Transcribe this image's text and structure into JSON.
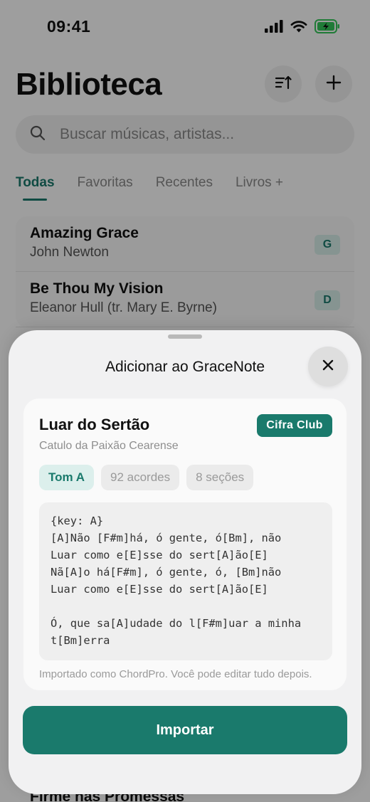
{
  "status_bar": {
    "time": "09:41",
    "icons": [
      "cellular-signal-icon",
      "wifi-icon",
      "battery-charging-icon"
    ],
    "battery_color": "#34c759"
  },
  "header": {
    "title": "Biblioteca",
    "sort_icon": "sort-icon",
    "add_icon": "plus-icon"
  },
  "search": {
    "placeholder": "Buscar músicas, artistas..."
  },
  "tabs": [
    {
      "label": "Todas",
      "active": true
    },
    {
      "label": "Favoritas",
      "active": false
    },
    {
      "label": "Recentes",
      "active": false
    },
    {
      "label": "Livros +",
      "active": false
    }
  ],
  "songs": [
    {
      "title": "Amazing Grace",
      "artist": "John Newton",
      "key": "G"
    },
    {
      "title": "Be Thou My Vision",
      "artist": "Eleanor Hull (tr. Mary E. Byrne)",
      "key": "D"
    }
  ],
  "peek_song_title": "Firme nas Promessas",
  "sheet": {
    "title": "Adicionar ao GraceNote",
    "close_icon": "close-icon",
    "song": {
      "title": "Luar do Sertão",
      "artist": "Catulo da Paixão Cearense",
      "source": "Cifra Club",
      "key_chip": "Tom A",
      "chords_chip": "92 acordes",
      "sections_chip": "8 seções"
    },
    "chordpro_lines": [
      "{key: A}",
      "[A]Não [F#m]há, ó gente, ó[Bm], não",
      "Luar como e[E]sse do sert[A]ão[E]",
      "Nã[A]o há[F#m], ó gente, ó, [Bm]não",
      "Luar como e[E]sse do sert[A]ão[E]",
      "",
      "Ó, que sa[A]udade do l[F#m]uar a minha",
      "t[Bm]erra"
    ],
    "note": "Importado como ChordPro. Você pode editar tudo depois.",
    "import_label": "Importar"
  },
  "colors": {
    "accent": "#1a7a6c",
    "accent_light": "#dcefec"
  }
}
